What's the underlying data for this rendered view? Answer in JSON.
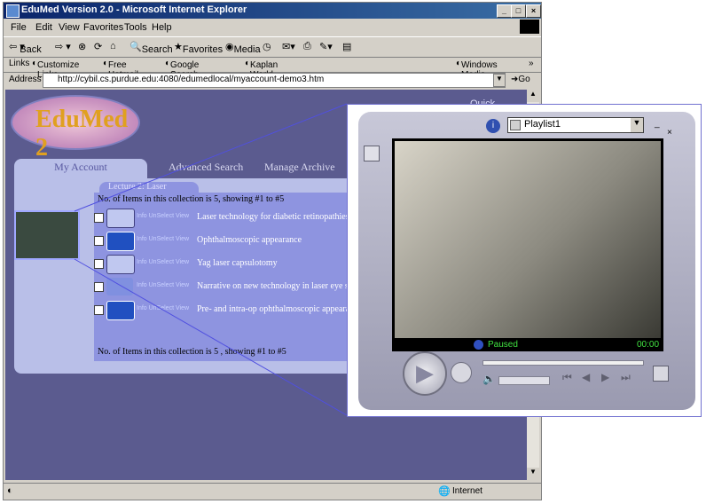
{
  "window": {
    "title": "EduMed Version 2.0 - Microsoft Internet Explorer"
  },
  "menu": [
    "File",
    "Edit",
    "View",
    "Favorites",
    "Tools",
    "Help"
  ],
  "toolbar": {
    "back": "Back",
    "search": "Search",
    "favorites": "Favorites",
    "media": "Media"
  },
  "links_bar": {
    "label": "Links",
    "items": [
      "Customize Links",
      "Free Hotmail",
      "Google Search APS",
      "Kaplan World Leader in Test Prep, Admissions and Tutoring",
      "Windows Media"
    ]
  },
  "address": {
    "label": "Address",
    "url": "http://cybil.cs.purdue.edu:4080/edumedlocal/myaccount-demo3.htm",
    "go": "Go"
  },
  "page": {
    "logo": "EduMed 2",
    "quick_search": "Quick Search",
    "tabs": [
      "My Account",
      "Advanced Search",
      "Manage Archive"
    ],
    "lecture_tab": "Lecture 2: Laser",
    "count_top": "No. of Items in this collection is 5, showing #1 to #5",
    "count_bottom": "No. of Items in this collection is 5 , showing #1 to #5",
    "row_links": "Info  UnSelect  View",
    "items": [
      {
        "title": "Laser technology for diabetic retinopathies",
        "icon": "video-reel-icon"
      },
      {
        "title": "Ophthalmoscopic appearance",
        "icon": "image-icon"
      },
      {
        "title": "Yag laser capsulotomy",
        "icon": "video-reel-icon"
      },
      {
        "title": "Narrative on new technology in laser eye sur",
        "icon": "audio-wave-icon"
      },
      {
        "title": "Pre- and intra-op ophthalmoscopic appearan",
        "icon": "image-icon"
      }
    ]
  },
  "status": {
    "zone": "Internet"
  },
  "player": {
    "playlist": "Playlist1",
    "state": "Paused",
    "time": "00:00"
  },
  "colors": {
    "titlebar": "#0a246a",
    "page_bg": "#5b5b8f",
    "panel": "#b9bfe8",
    "list": "#8e94e0",
    "status_green": "#40e040"
  }
}
